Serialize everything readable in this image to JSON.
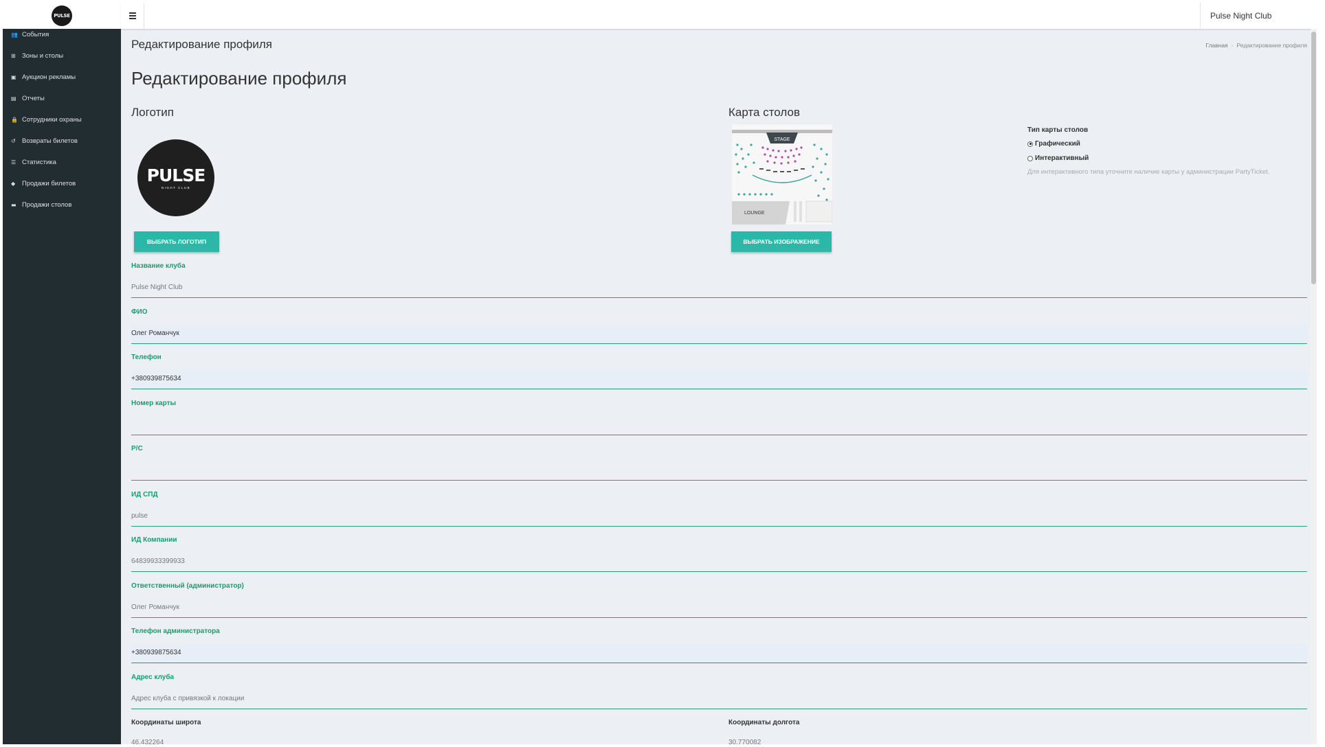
{
  "header": {
    "logo_text": "PULSE",
    "club_name": "Pulse Night Club"
  },
  "sidebar": {
    "items": [
      {
        "label": "События",
        "icon": "users-icon"
      },
      {
        "label": "Зоны и столы",
        "icon": "sitemap-icon"
      },
      {
        "label": "Аукцион рекламы",
        "icon": "money-icon"
      },
      {
        "label": "Отчеты",
        "icon": "file-icon"
      },
      {
        "label": "Сотрудники охраны",
        "icon": "lock-icon"
      },
      {
        "label": "Возвраты билетов",
        "icon": "undo-icon"
      },
      {
        "label": "Статистика",
        "icon": "list-icon"
      },
      {
        "label": "Продажи билетов",
        "icon": "tag-icon"
      },
      {
        "label": "Продажи столов",
        "icon": "folder-icon"
      }
    ]
  },
  "content_header": {
    "title": "Редактирование профиля",
    "breadcrumb_home": "Главная",
    "breadcrumb_current": "Редактирование профиля"
  },
  "page": {
    "title": "Редактирование профиля",
    "logo_section_title": "Логотип",
    "logo_brand": "PULSE",
    "logo_sub": "NIGHT CLUB",
    "choose_logo_button": "ВЫБРАТЬ ЛОГОТИП",
    "map_section_title": "Карта столов",
    "map_stage_label": "STAGE",
    "map_lounge_label": "LOUNGE",
    "choose_image_button": "ВЫБРАТЬ ИЗОБРАЖЕНИЕ",
    "map_type_title": "Тип карты столов",
    "map_type_options": [
      {
        "label": "Графический",
        "checked": true
      },
      {
        "label": "Интерактивный",
        "checked": false
      }
    ],
    "map_type_hint": "Для интерактивного типа уточните наличие карты у администрации PartyTicket."
  },
  "form": {
    "fields": [
      {
        "label": "Название клуба",
        "value": "Pulse Night Club",
        "filled": false,
        "muted": true
      },
      {
        "label": "ФИО",
        "value": "Олег Романчук",
        "filled": true,
        "muted": false
      },
      {
        "label": "Телефон",
        "value": "+380939875634",
        "filled": true,
        "muted": false
      },
      {
        "label": "Номер карты",
        "value": "",
        "filled": false,
        "muted": false
      },
      {
        "label": "Р/С",
        "value": "",
        "filled": false,
        "muted": false
      },
      {
        "label": "ИД СПД",
        "value": "pulse",
        "filled": false,
        "muted": true
      },
      {
        "label": "ИД Компании",
        "value": "64839933399933",
        "filled": false,
        "muted": true
      },
      {
        "label": "Ответственный (администратор)",
        "value": "Олег Романчук",
        "filled": false,
        "muted": true
      },
      {
        "label": "Телефон администратора",
        "value": "+380939875634",
        "filled": true,
        "muted": false
      },
      {
        "label": "Адрес клуба",
        "value": "",
        "placeholder": "Адрес клуба с привязкой к локации",
        "filled": false,
        "muted": true
      }
    ],
    "latitude_label": "Координаты широта",
    "latitude_value": "46.432264",
    "longitude_label": "Координаты долгота",
    "longitude_value": "30.770082"
  },
  "colors": {
    "sidebar_bg": "#222d32",
    "content_bg": "#ecf0f5",
    "accent_teal": "#2bb8a8",
    "label_green": "#1c9a6c"
  }
}
